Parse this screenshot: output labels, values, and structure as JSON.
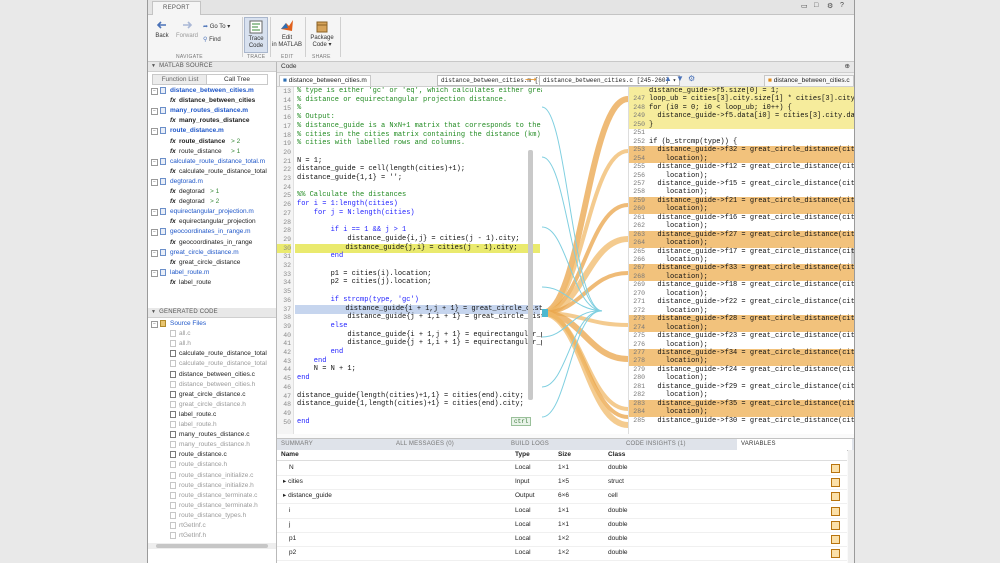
{
  "toolstrip": {
    "tab_label": "REPORT",
    "back": "Back",
    "forward": "Forward",
    "goto": "Go To",
    "find": "Find",
    "trace_code": [
      "Trace",
      "Code"
    ],
    "edit_in_matlab": [
      "Edit",
      "in MATLAB"
    ],
    "package_code": [
      "Package",
      "Code"
    ],
    "groups": {
      "navigate": "NAVIGATE",
      "trace": "TRACE",
      "edit": "EDIT",
      "share": "SHARE"
    }
  },
  "left_panel": {
    "header": "MATLAB SOURCE",
    "tabs": [
      "Function List",
      "Call Tree"
    ],
    "tree": [
      {
        "type": "file",
        "label": "distance_between_cities.m",
        "bold": true
      },
      {
        "type": "fn",
        "label": "distance_between_cities",
        "bold": true
      },
      {
        "type": "file",
        "label": "many_routes_distance.m",
        "bold": true
      },
      {
        "type": "fn",
        "label": "many_routes_distance",
        "bold": true
      },
      {
        "type": "file",
        "label": "route_distance.m",
        "bold": true
      },
      {
        "type": "fn",
        "label": "route_distance",
        "bold": true,
        "suffix": "> 2"
      },
      {
        "type": "fn",
        "label": "route_distance",
        "bold": false,
        "suffix": "> 1"
      },
      {
        "type": "file",
        "label": "calculate_route_distance_total.m",
        "bold": false
      },
      {
        "type": "fn",
        "label": "calculate_route_distance_total",
        "bold": false
      },
      {
        "type": "file",
        "label": "degtorad.m",
        "bold": false
      },
      {
        "type": "fn",
        "label": "degtorad",
        "bold": false,
        "suffix": "> 1"
      },
      {
        "type": "fn",
        "label": "degtorad",
        "bold": false,
        "suffix": "> 2"
      },
      {
        "type": "file",
        "label": "equirectangular_projection.m",
        "bold": false
      },
      {
        "type": "fn",
        "label": "equirectangular_projection",
        "bold": false
      },
      {
        "type": "file",
        "label": "geocoordinates_in_range.m",
        "bold": false
      },
      {
        "type": "fn",
        "label": "geocoordinates_in_range",
        "bold": false
      },
      {
        "type": "file",
        "label": "great_circle_distance.m",
        "bold": false
      },
      {
        "type": "fn",
        "label": "great_circle_distance",
        "bold": false
      },
      {
        "type": "file",
        "label": "label_route.m",
        "bold": false
      },
      {
        "type": "fn",
        "label": "label_route",
        "bold": false
      }
    ],
    "generated_header": "GENERATED CODE",
    "source_files_label": "Source Files",
    "generated_files": [
      {
        "label": "all.c",
        "active": false
      },
      {
        "label": "all.h",
        "active": false
      },
      {
        "label": "calculate_route_distance_total",
        "active": true
      },
      {
        "label": "calculate_route_distance_total",
        "active": false
      },
      {
        "label": "distance_between_cities.c",
        "active": true
      },
      {
        "label": "distance_between_cities.h",
        "active": false
      },
      {
        "label": "great_circle_distance.c",
        "active": true
      },
      {
        "label": "great_circle_distance.h",
        "active": false
      },
      {
        "label": "label_route.c",
        "active": true
      },
      {
        "label": "label_route.h",
        "active": false
      },
      {
        "label": "many_routes_distance.c",
        "active": true
      },
      {
        "label": "many_routes_distance.h",
        "active": false
      },
      {
        "label": "route_distance.c",
        "active": true
      },
      {
        "label": "route_distance.h",
        "active": false
      },
      {
        "label": "route_distance_initialize.c",
        "active": false
      },
      {
        "label": "route_distance_initialize.h",
        "active": false
      },
      {
        "label": "route_distance_terminate.c",
        "active": false
      },
      {
        "label": "route_distance_terminate.h",
        "active": false
      },
      {
        "label": "route_distance_types.h",
        "active": false
      },
      {
        "label": "rtGetInf.c",
        "active": false
      },
      {
        "label": "rtGetInf.h",
        "active": false
      }
    ]
  },
  "editor": {
    "header": "Code",
    "tab_source": "distance_between_cities.m",
    "crumb_left": "distance_between_cities.m [30]",
    "crumb_right": "distance_between_cities.c [245-260]",
    "tab_generated": "distance_between_cities.c",
    "ctrl_hint": "ctrl",
    "ribbon_badge": "6",
    "source_lines": [
      {
        "n": "13",
        "t": "% type is either 'gc' or 'eq', which calculates either great",
        "c": "cm"
      },
      {
        "n": "14",
        "t": "% distance or equirectangular projection distance.",
        "c": "cm"
      },
      {
        "n": "15",
        "t": "%",
        "c": "cm"
      },
      {
        "n": "16",
        "t": "% Output:",
        "c": "cm"
      },
      {
        "n": "17",
        "t": "% distance_guide is a NxN+1 matrix that corresponds to the",
        "c": "cm"
      },
      {
        "n": "18",
        "t": "% cities in the cities matrix containing the distance (km) b",
        "c": "cm"
      },
      {
        "n": "19",
        "t": "% cities with labelled rows and columns.",
        "c": "cm"
      },
      {
        "n": "20",
        "t": "",
        "c": ""
      },
      {
        "n": "21",
        "t": "N = 1;",
        "c": ""
      },
      {
        "n": "22",
        "t": "distance_guide = cell(length(cities)+1);",
        "c": ""
      },
      {
        "n": "23",
        "t": "distance_guide{1,1} = '';",
        "c": ""
      },
      {
        "n": "24",
        "t": "",
        "c": ""
      },
      {
        "n": "25",
        "t": "%% Calculate the distances",
        "c": "cm"
      },
      {
        "n": "26",
        "t": "for i = 1:length(cities)",
        "c": "kw1"
      },
      {
        "n": "27",
        "t": "    for j = N:length(cities)",
        "c": "kw1"
      },
      {
        "n": "28",
        "t": "",
        "c": ""
      },
      {
        "n": "28",
        "t": "        if i == 1 && j > 1",
        "c": "kw1"
      },
      {
        "n": "29",
        "t": "            distance_guide{i,j} = cities(j - 1).city;",
        "c": ""
      },
      {
        "n": "30",
        "t": "            distance_guide{j,i} = cities(j - 1).city;",
        "c": "hy"
      },
      {
        "n": "31",
        "t": "        end",
        "c": "kw"
      },
      {
        "n": "32",
        "t": "",
        "c": ""
      },
      {
        "n": "33",
        "t": "        p1 = cities(i).location;",
        "c": ""
      },
      {
        "n": "34",
        "t": "        p2 = cities(j).location;",
        "c": ""
      },
      {
        "n": "35",
        "t": "",
        "c": ""
      },
      {
        "n": "36",
        "t": "        if strcmp(type, 'gc')",
        "c": "kw1"
      },
      {
        "n": "37",
        "t": "            distance_guide{i + 1,j + 1} = great_circle_dista",
        "c": "hb"
      },
      {
        "n": "38",
        "t": "            distance_guide{j + 1,i + 1} = great_circle_dista",
        "c": ""
      },
      {
        "n": "39",
        "t": "        else",
        "c": "kw"
      },
      {
        "n": "40",
        "t": "            distance_guide{i + 1,j + 1} = equirectangular_pr",
        "c": ""
      },
      {
        "n": "41",
        "t": "            distance_guide{j + 1,i + 1} = equirectangular_pr",
        "c": ""
      },
      {
        "n": "42",
        "t": "        end",
        "c": "kw"
      },
      {
        "n": "43",
        "t": "    end",
        "c": "kw"
      },
      {
        "n": "44",
        "t": "    N = N + 1;",
        "c": ""
      },
      {
        "n": "45",
        "t": "end",
        "c": "kw"
      },
      {
        "n": "46",
        "t": "",
        "c": ""
      },
      {
        "n": "47",
        "t": "distance_guide{length(cities)+1,1} = cities(end).city;",
        "c": ""
      },
      {
        "n": "48",
        "t": "distance_guide{1,length(cities)+1} = cities(end).city;",
        "c": ""
      },
      {
        "n": "49",
        "t": "",
        "c": ""
      },
      {
        "n": "50",
        "t": "end",
        "c": "kw"
      }
    ],
    "generated_lines": [
      {
        "n": "",
        "t": "distance_guide->f5.size[0] = 1;",
        "b": "y"
      },
      {
        "n": "247",
        "t": "loop_ub = cities[3].city.size[1] * cities[3].city.size[0",
        "b": "y"
      },
      {
        "n": "248",
        "t": "for (i0 = 0; i0 < loop_ub; i0++) {",
        "b": "y"
      },
      {
        "n": "249",
        "t": "  distance_guide->f5.data[i0] = cities[3].city.data[i0];",
        "b": "y"
      },
      {
        "n": "250",
        "t": "}",
        "b": "y"
      },
      {
        "n": "251",
        "t": "",
        "b": ""
      },
      {
        "n": "252",
        "t": "if (b_strcmp(type)) {",
        "b": ""
      },
      {
        "n": "253",
        "t": "  distance_guide->f32 = great_circle_distance(cities[0].",
        "b": "o"
      },
      {
        "n": "254",
        "t": "    location);",
        "b": "o"
      },
      {
        "n": "255",
        "t": "  distance_guide->f12 = great_circle_distance(cities[0].",
        "b": ""
      },
      {
        "n": "256",
        "t": "    location);",
        "b": ""
      },
      {
        "n": "257",
        "t": "  distance_guide->f15 = great_circle_distance(cities[1].",
        "b": ""
      },
      {
        "n": "258",
        "t": "    location);",
        "b": ""
      },
      {
        "n": "259",
        "t": "  distance_guide->f21 = great_circle_distance(cities[1].",
        "b": "o"
      },
      {
        "n": "260",
        "t": "    location);",
        "b": "o"
      },
      {
        "n": "261",
        "t": "  distance_guide->f16 = great_circle_distance(cities[1].",
        "b": ""
      },
      {
        "n": "262",
        "t": "    location);",
        "b": ""
      },
      {
        "n": "263",
        "t": "  distance_guide->f27 = great_circle_distance(cities[1].",
        "b": "o"
      },
      {
        "n": "264",
        "t": "    location);",
        "b": "o"
      },
      {
        "n": "265",
        "t": "  distance_guide->f17 = great_circle_distance(cities[1].",
        "b": ""
      },
      {
        "n": "266",
        "t": "    location);",
        "b": ""
      },
      {
        "n": "267",
        "t": "  distance_guide->f33 = great_circle_distance(cities[1].",
        "b": "o"
      },
      {
        "n": "268",
        "t": "    location);",
        "b": "o"
      },
      {
        "n": "269",
        "t": "  distance_guide->f18 = great_circle_distance(cities[1].",
        "b": ""
      },
      {
        "n": "270",
        "t": "    location);",
        "b": ""
      },
      {
        "n": "271",
        "t": "  distance_guide->f22 = great_circle_distance(cities[2].",
        "b": ""
      },
      {
        "n": "272",
        "t": "    location);",
        "b": ""
      },
      {
        "n": "273",
        "t": "  distance_guide->f28 = great_circle_distance(cities[2].",
        "b": "o"
      },
      {
        "n": "274",
        "t": "    location);",
        "b": "o"
      },
      {
        "n": "275",
        "t": "  distance_guide->f23 = great_circle_distance(cities[2].",
        "b": ""
      },
      {
        "n": "276",
        "t": "    location);",
        "b": ""
      },
      {
        "n": "277",
        "t": "  distance_guide->f34 = great_circle_distance(cities[2].",
        "b": "o"
      },
      {
        "n": "278",
        "t": "    location);",
        "b": "o"
      },
      {
        "n": "279",
        "t": "  distance_guide->f24 = great_circle_distance(cities[2].",
        "b": ""
      },
      {
        "n": "280",
        "t": "    location);",
        "b": ""
      },
      {
        "n": "281",
        "t": "  distance_guide->f29 = great_circle_distance(cities[3].",
        "b": ""
      },
      {
        "n": "282",
        "t": "    location);",
        "b": ""
      },
      {
        "n": "283",
        "t": "  distance_guide->f35 = great_circle_distance(cities[3].",
        "b": "o"
      },
      {
        "n": "284",
        "t": "    location);",
        "b": "o"
      },
      {
        "n": "285",
        "t": "  distance_guide->f30 = great_circle_distance(cities[3].",
        "b": ""
      }
    ]
  },
  "bottom": {
    "tabs": [
      "SUMMARY",
      "ALL MESSAGES (0)",
      "BUILD LOGS",
      "CODE INSIGHTS (1)",
      "VARIABLES"
    ],
    "columns": [
      "Name",
      "Type",
      "Size",
      "Class"
    ],
    "rows": [
      {
        "name": "N",
        "expand": false,
        "type": "Local",
        "size": "1×1",
        "class": "double"
      },
      {
        "name": "cities",
        "expand": true,
        "type": "Input",
        "size": "1×5",
        "class": "struct"
      },
      {
        "name": "distance_guide",
        "expand": true,
        "type": "Output",
        "size": "6×6",
        "class": "cell"
      },
      {
        "name": "i",
        "expand": false,
        "type": "Local",
        "size": "1×1",
        "class": "double"
      },
      {
        "name": "j",
        "expand": false,
        "type": "Local",
        "size": "1×1",
        "class": "double"
      },
      {
        "name": "p1",
        "expand": false,
        "type": "Local",
        "size": "1×2",
        "class": "double"
      },
      {
        "name": "p2",
        "expand": false,
        "type": "Local",
        "size": "1×2",
        "class": "double"
      }
    ]
  }
}
